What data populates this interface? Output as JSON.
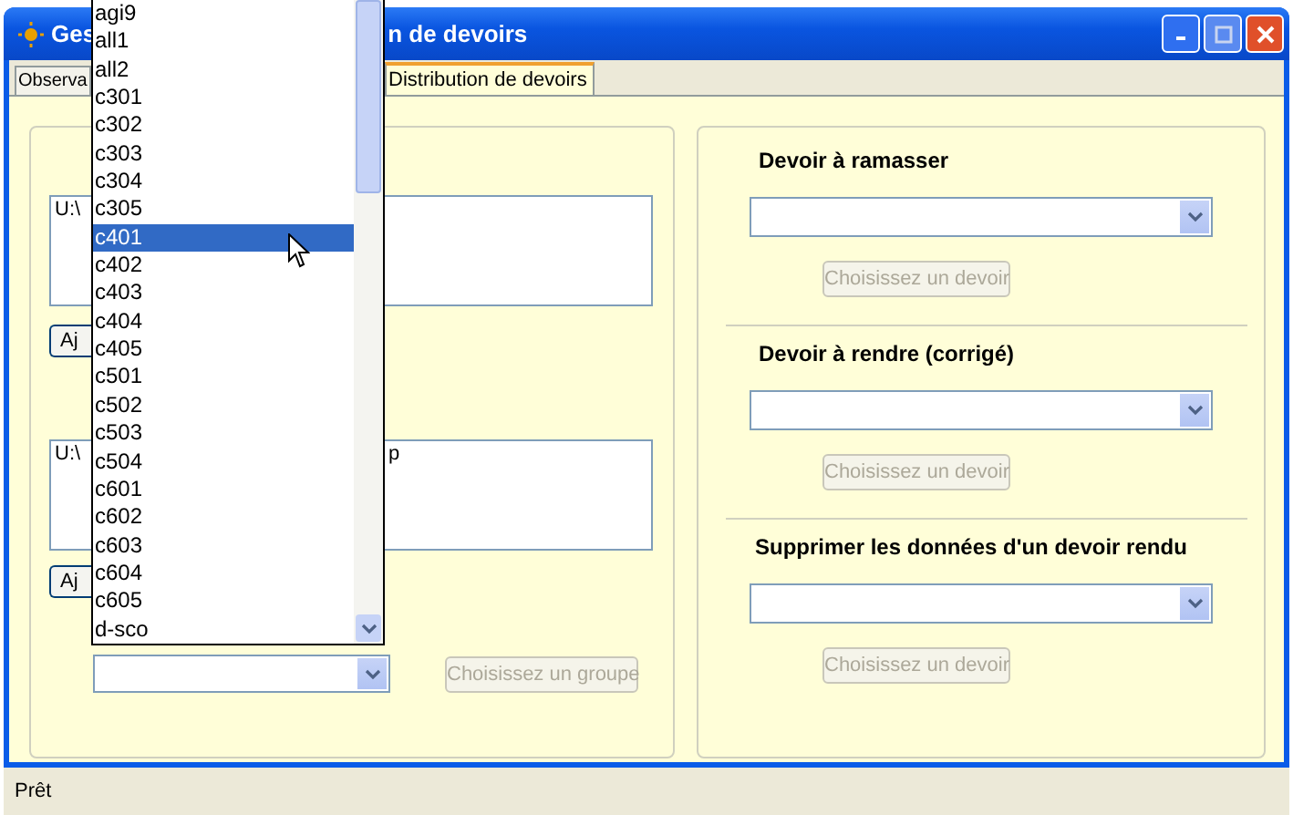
{
  "window": {
    "title_parts": [
      "Ges",
      "n de devoirs"
    ]
  },
  "tabs": [
    {
      "label": "Observa",
      "selected": false
    },
    {
      "label": "Distribution de devoirs",
      "selected": true
    }
  ],
  "left_panel": {
    "path_boxes": [
      {
        "text": "U:\\"
      },
      {
        "text": "U:\\",
        "text_2": "p"
      }
    ],
    "add_buttons": [
      "Aj",
      "Aj"
    ],
    "group_button": {
      "label": "Choisissez un groupe",
      "disabled": true
    }
  },
  "group_dropdown_list": {
    "items": [
      {
        "label": "agi9",
        "selected": false
      },
      {
        "label": "all1",
        "selected": false
      },
      {
        "label": "all2",
        "selected": false
      },
      {
        "label": "c301",
        "selected": false
      },
      {
        "label": "c302",
        "selected": false
      },
      {
        "label": "c303",
        "selected": false
      },
      {
        "label": "c304",
        "selected": false
      },
      {
        "label": "c305",
        "selected": false
      },
      {
        "label": "c401",
        "selected": true
      },
      {
        "label": "c402",
        "selected": false
      },
      {
        "label": "c403",
        "selected": false
      },
      {
        "label": "c404",
        "selected": false
      },
      {
        "label": "c405",
        "selected": false
      },
      {
        "label": "c501",
        "selected": false
      },
      {
        "label": "c502",
        "selected": false
      },
      {
        "label": "c503",
        "selected": false
      },
      {
        "label": "c504",
        "selected": false
      },
      {
        "label": "c601",
        "selected": false
      },
      {
        "label": "c602",
        "selected": false
      },
      {
        "label": "c603",
        "selected": false
      },
      {
        "label": "c604",
        "selected": false
      },
      {
        "label": "c605",
        "selected": false
      },
      {
        "label": "d-sco",
        "selected": false
      }
    ]
  },
  "right_panel": {
    "sections": [
      {
        "heading": "Devoir à ramasser",
        "button": "Choisissez un devoir",
        "disabled": true
      },
      {
        "heading": "Devoir à rendre (corrigé)",
        "button": "Choisissez un devoir",
        "disabled": true
      },
      {
        "heading": "Supprimer  les données d'un devoir rendu",
        "button": "Choisissez un devoir",
        "disabled": true
      }
    ]
  },
  "status_bar": "Prêt"
}
